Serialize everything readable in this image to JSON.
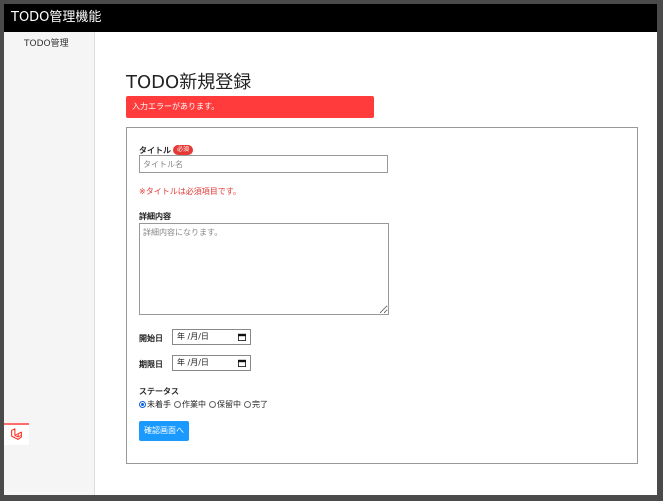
{
  "app": {
    "title": "TODO管理機能"
  },
  "sidebar": {
    "items": [
      {
        "label": "TODO管理"
      }
    ],
    "bottom_icon": "laravel-icon"
  },
  "main": {
    "page_title": "TODO新規登録",
    "error_banner": "入力エラーがあります。"
  },
  "form": {
    "title_label": "タイトル",
    "required_badge": "必須",
    "title_value": "",
    "title_placeholder": "タイトル名",
    "title_error": "※タイトルは必須項目です。",
    "detail_label": "詳細内容",
    "detail_value": "",
    "detail_placeholder": "詳細内容になります。",
    "start_label": "開始日",
    "start_value": "年 /月/日",
    "due_label": "期限日",
    "due_value": "年 /月/日",
    "status_label": "ステータス",
    "status_options": [
      {
        "label": "未着手",
        "checked": true
      },
      {
        "label": "作業中",
        "checked": false
      },
      {
        "label": "保留中",
        "checked": false
      },
      {
        "label": "完了",
        "checked": false
      }
    ],
    "confirm_button": "確認画面へ"
  },
  "colors": {
    "topbar": "#000000",
    "error_banner": "#ff3b3b",
    "error_text": "#e53935",
    "required_badge": "#e53935",
    "primary_button": "#1a9aff",
    "radio_checked": "#0b62d6"
  }
}
